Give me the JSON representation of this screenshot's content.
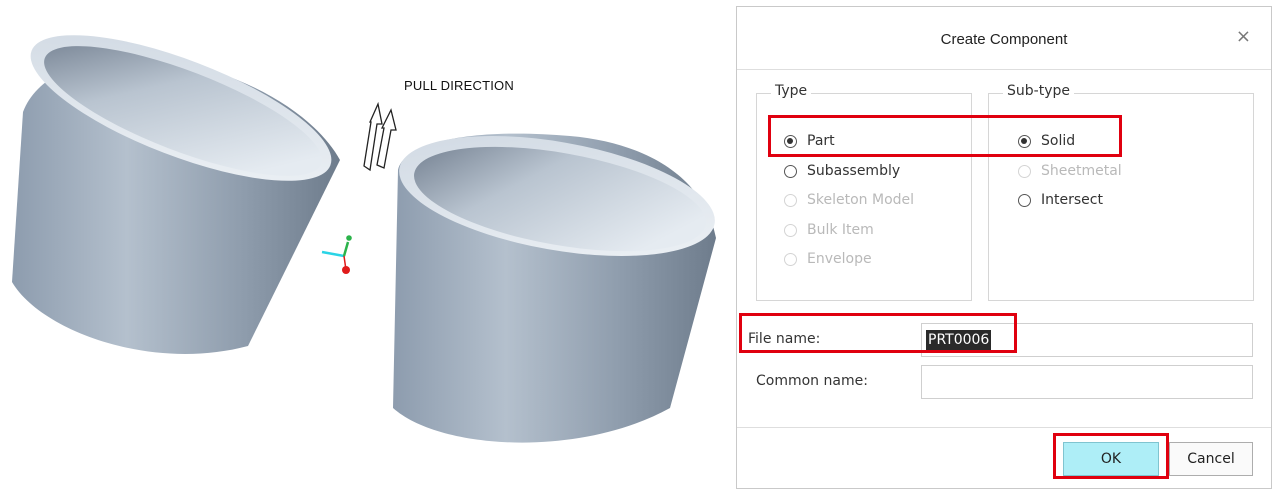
{
  "viewport": {
    "pull_direction_label": "PULL DIRECTION"
  },
  "dialog": {
    "title": "Create Component",
    "close_glyph": "×",
    "type_group": {
      "legend": "Type",
      "options": [
        {
          "label": "Part",
          "selected": true,
          "enabled": true
        },
        {
          "label": "Subassembly",
          "selected": false,
          "enabled": true
        },
        {
          "label": "Skeleton Model",
          "selected": false,
          "enabled": false
        },
        {
          "label": "Bulk Item",
          "selected": false,
          "enabled": false
        },
        {
          "label": "Envelope",
          "selected": false,
          "enabled": false
        }
      ]
    },
    "subtype_group": {
      "legend": "Sub-type",
      "options": [
        {
          "label": "Solid",
          "selected": true,
          "enabled": true
        },
        {
          "label": "Sheetmetal",
          "selected": false,
          "enabled": false
        },
        {
          "label": "Intersect",
          "selected": false,
          "enabled": true
        }
      ]
    },
    "file_name": {
      "label": "File name:",
      "value": "PRT0006"
    },
    "common_name": {
      "label": "Common name:",
      "value": ""
    },
    "ok_label": "OK",
    "cancel_label": "Cancel"
  },
  "colors": {
    "highlight": "#e0000f",
    "ok_button": "#aeeef7",
    "part_body": "#a9b7c6"
  }
}
